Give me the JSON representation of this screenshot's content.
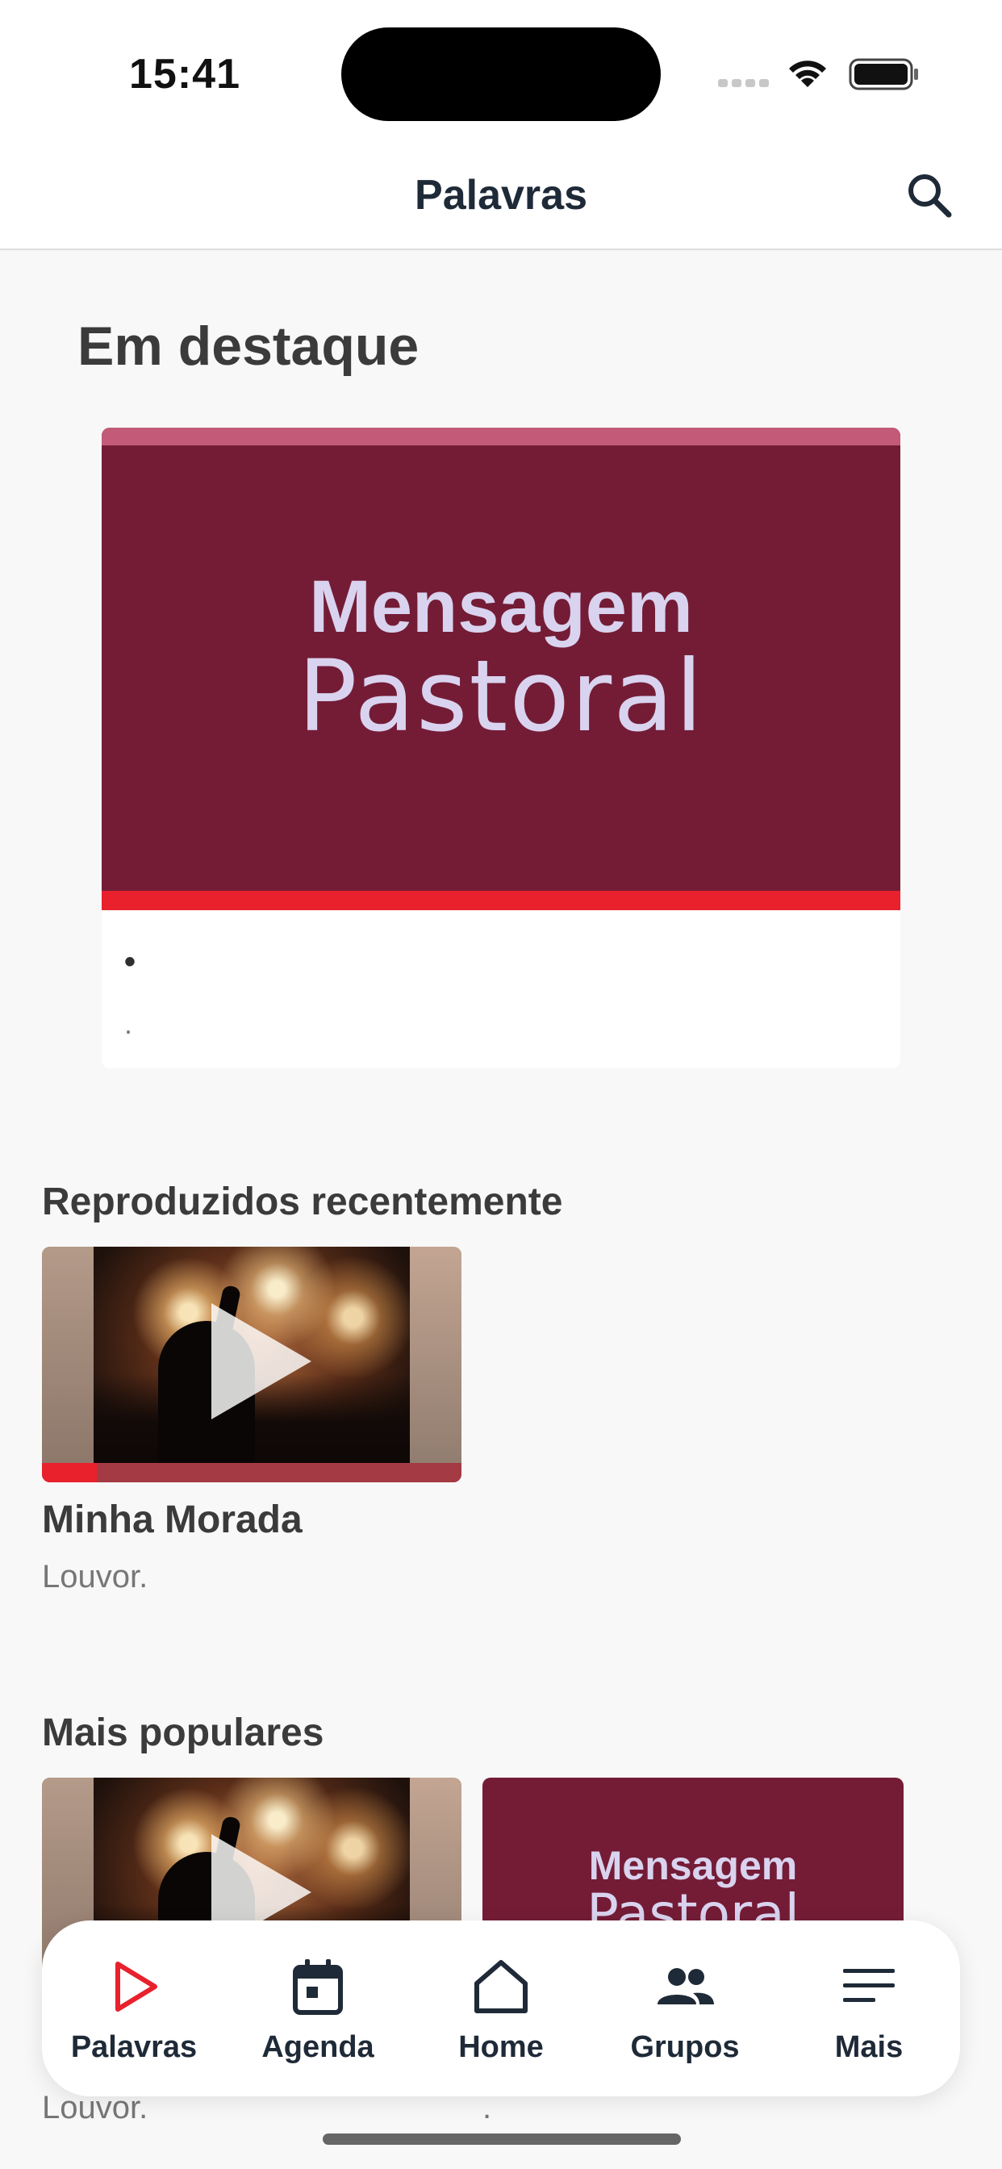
{
  "status_bar": {
    "time": "15:41"
  },
  "header": {
    "title": "Palavras"
  },
  "featured": {
    "section_title": "Em destaque",
    "banner_line1": "Mensagem",
    "banner_line2": "Pastoral",
    "item_title": "•",
    "item_subtitle": "."
  },
  "recent": {
    "section_title": "Reproduzidos recentemente",
    "items": [
      {
        "title": "Minha Morada",
        "subtitle": "Louvor.",
        "progress": 0.13
      }
    ]
  },
  "popular": {
    "section_title": "Mais populares",
    "items": [
      {
        "subtitle": "Louvor."
      },
      {
        "banner_line1": "Mensagem",
        "banner_line2": "Pastoral",
        "subtitle": "."
      }
    ]
  },
  "tabbar": {
    "tabs": [
      {
        "label": "Palavras",
        "icon": "play-icon",
        "active": true
      },
      {
        "label": "Agenda",
        "icon": "calendar-icon",
        "active": false
      },
      {
        "label": "Home",
        "icon": "home-icon",
        "active": false
      },
      {
        "label": "Grupos",
        "icon": "groups-icon",
        "active": false
      },
      {
        "label": "Mais",
        "icon": "menu-icon",
        "active": false
      }
    ]
  },
  "colors": {
    "accent": "#e8212d",
    "banner": "#741c36",
    "banner_text": "#d9d3ef",
    "nav_text": "#1f2a38"
  }
}
